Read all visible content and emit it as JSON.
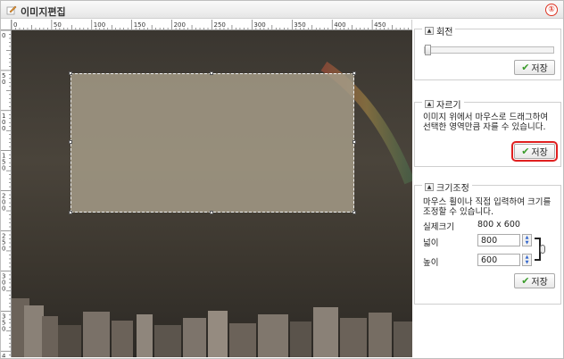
{
  "window": {
    "title": "이미지편집",
    "badge": "①"
  },
  "ruler": {
    "top_labels": [
      "0",
      "50",
      "100",
      "150",
      "200",
      "250",
      "300",
      "350",
      "400",
      "450",
      "50"
    ],
    "left_labels": [
      "0",
      "50",
      "100",
      "150",
      "200",
      "250",
      "300",
      "350",
      "400"
    ]
  },
  "rotate": {
    "title": "회전",
    "slider_value": 0,
    "save_label": "저장"
  },
  "crop": {
    "title": "자르기",
    "description": "이미지 위에서 마우스로 드래그하여 선택한 영역만큼 자를 수 있습니다.",
    "save_label": "저장"
  },
  "resize": {
    "title": "크기조정",
    "description": "마우스 휠이나 직접 입력하여 크기를 조정할 수 있습니다.",
    "actual_label": "실제크기",
    "actual_value": "800 x 600",
    "width_label": "넓이",
    "width_value": "800",
    "height_label": "높이",
    "height_value": "600",
    "save_label": "저장"
  },
  "colors": {
    "highlight": "#e02020",
    "check": "#3a9b2a"
  }
}
